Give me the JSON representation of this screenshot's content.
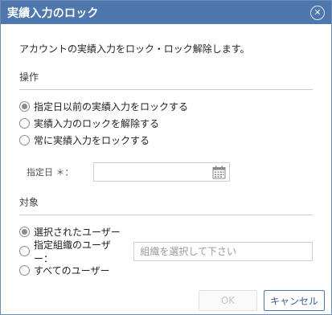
{
  "dialog": {
    "title": "実績入力のロック",
    "close_glyph": "✕",
    "description": "アカウントの実績入力をロック・ロック解除します。"
  },
  "operation": {
    "label": "操作",
    "options": [
      {
        "label": "指定日以前の実績入力をロックする",
        "checked": true
      },
      {
        "label": "実績入力のロックを解除する",
        "checked": false
      },
      {
        "label": "常に実績入力をロックする",
        "checked": false
      }
    ],
    "date_label": "指定日 ＊：",
    "date_value": ""
  },
  "target": {
    "label": "対象",
    "options": [
      {
        "label": "選択されたユーザー",
        "checked": true
      },
      {
        "label": "指定組織のユーザー：",
        "checked": false
      },
      {
        "label": "すべてのユーザー",
        "checked": false
      }
    ],
    "org_placeholder": "組織を選択して下さい"
  },
  "buttons": {
    "ok": "OK",
    "cancel": "キャンセル"
  },
  "colors": {
    "titlebar": "#4d77ad",
    "border": "#6f8db4"
  }
}
